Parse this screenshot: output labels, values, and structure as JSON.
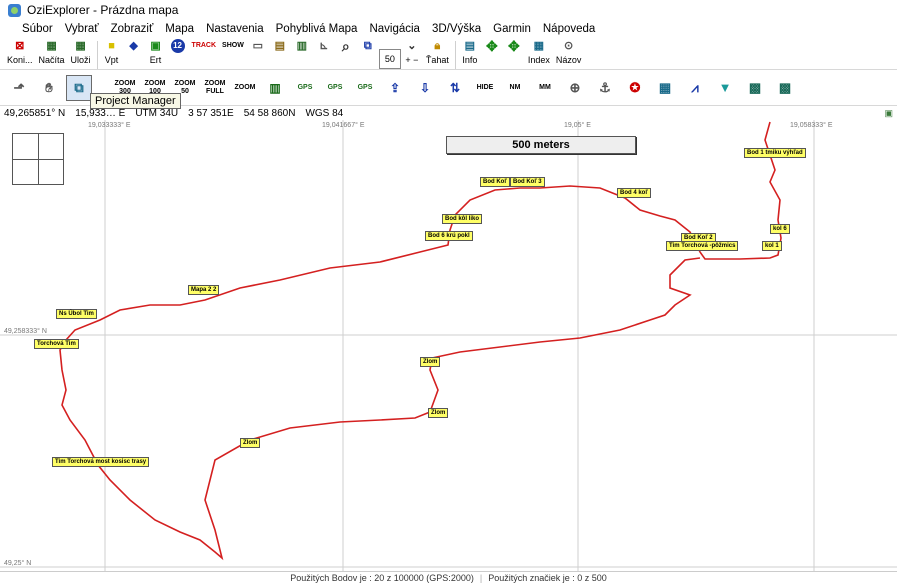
{
  "window": {
    "title": "OziExplorer - Prázdna mapa"
  },
  "menu": [
    "Súbor",
    "Vybrať",
    "Zobraziť",
    "Mapa",
    "Nastavenia",
    "Pohyblivá Mapa",
    "Navigácia",
    "3D/Výška",
    "Garmin",
    "Nápoveda"
  ],
  "toolbar1": {
    "koni": "Koni...",
    "nacita": "Načíta",
    "ulozi": "Uloži",
    "vpt": "Vpt",
    "ert": "Ert",
    "track": "TRACK",
    "show": "SHOW",
    "zoom_value": "50",
    "tahat": "Ťahat",
    "info": "Info",
    "index": "Index",
    "nazov": "Názov"
  },
  "toolbar2": {
    "zoom_labels": [
      "ZOOM 300",
      "ZOOM 100",
      "ZOOM 50",
      "ZOOM FULL",
      "ZOOM"
    ],
    "gps_labels": [
      "GPS",
      "GPS",
      "GPS"
    ],
    "misc_labels": [
      "HIDE",
      "NM",
      "MM"
    ]
  },
  "tooltip": "Project Manager",
  "status": {
    "lat": "49,265851° N",
    "lon": "15,933… E",
    "utm": "UTM 34U",
    "easting": "3 57 351E",
    "northing": "54 58 860N",
    "datum": "WGS 84"
  },
  "grid": {
    "top_labels": [
      "19,033333° E",
      "19,041667° E",
      "19,05° E",
      "19,058333° E"
    ],
    "left_labels": [
      "49,258333° N",
      "49,25° N"
    ]
  },
  "scale": "500 meters",
  "waypoints": [
    "Bod 1 tmiku výhľad",
    "Bod Koľ",
    "Bod Koľ 3",
    "Bod 4 koľ",
    "kol 6",
    "kol 1",
    "Bod Koľ 2",
    "Tim Torchová -pôžmics",
    "Bod kôl liko",
    "Bod 6 krú pokl",
    "Mapa 2 2",
    "Ns Úbol Tim",
    "Torchová Tim",
    "Zlom",
    "Zlom",
    "Zlom",
    "Tim Torchová most kosisc trasy"
  ],
  "statusbar": {
    "left": "Použitých Bodov je : 20 z 100000 (GPS:2000)",
    "right": "Použitých značiek je : 0 z 500"
  },
  "colors": {
    "track": "#d42020",
    "waypoint": "#ffff66",
    "menu_bg": "#ffffff"
  }
}
